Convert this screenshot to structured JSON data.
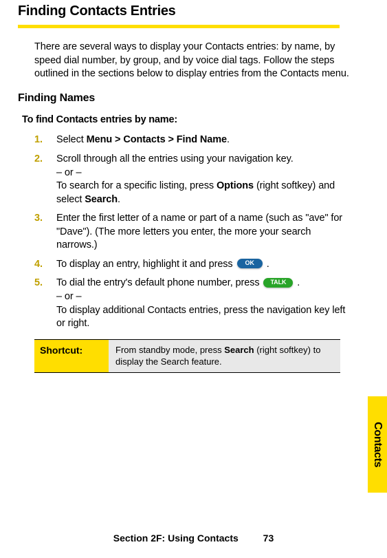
{
  "title": "Finding Contacts Entries",
  "intro": "There are several ways to display your Contacts entries: by name, by speed dial number, by group, and by voice dial tags. Follow the steps outlined in the sections below to display entries from the Contacts menu.",
  "subHeading": "Finding Names",
  "instructionHeading": "To find Contacts entries by name:",
  "steps": {
    "s1": {
      "num": "1.",
      "lead": "Select ",
      "bold1": "Menu > Contacts > Find Name",
      "tail": "."
    },
    "s2": {
      "num": "2.",
      "line1": "Scroll through all the entries using your navigation key.",
      "or": "– or –",
      "line2a": "To search for a specific listing, press ",
      "bold1": "Options",
      "line2b": " (right softkey) and select ",
      "bold2": "Search",
      "tail": "."
    },
    "s3": {
      "num": "3.",
      "text": "Enter the first letter of a name or part of a name (such as \"ave\" for \"Dave\"). (The more letters you enter, the more your search narrows.)"
    },
    "s4": {
      "num": "4.",
      "lead": "To display an entry, highlight it and press ",
      "key": "OK",
      "tail": " ."
    },
    "s5": {
      "num": "5.",
      "lead": "To dial the entry's default phone number, press ",
      "key": "TALK",
      "tail": " .",
      "or": "– or –",
      "line2": "To display additional Contacts entries, press the navigation key left or right."
    }
  },
  "shortcut": {
    "label": "Shortcut:",
    "textA": "From standby mode, press ",
    "bold": "Search",
    "textB": " (right softkey) to display the Search feature."
  },
  "sideTab": "Contacts",
  "footer": {
    "section": "Section 2F: Using Contacts",
    "page": "73"
  }
}
